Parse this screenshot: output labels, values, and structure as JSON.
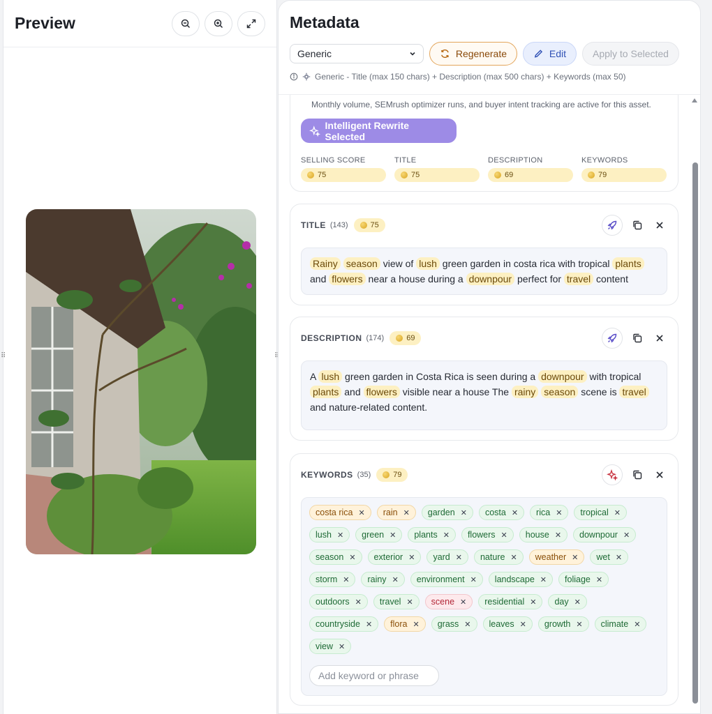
{
  "preview": {
    "title": "Preview",
    "tools": [
      {
        "name": "zoom-out-icon"
      },
      {
        "name": "zoom-in-icon"
      },
      {
        "name": "expand-icon"
      }
    ]
  },
  "metadata": {
    "title": "Metadata",
    "preset_select": "Generic",
    "regenerate_label": "Regenerate",
    "edit_label": "Edit",
    "apply_label": "Apply to Selected",
    "hint": "Generic - Title (max 150 chars) + Description (max 500 chars) + Keywords (max 50)"
  },
  "score_card": {
    "note": "Monthly volume, SEMrush optimizer runs, and buyer intent tracking are active for this asset.",
    "rewrite_label": "Intelligent Rewrite Selected",
    "scores": [
      {
        "label": "SELLING SCORE",
        "value": "75"
      },
      {
        "label": "TITLE",
        "value": "75"
      },
      {
        "label": "DESCRIPTION",
        "value": "69"
      },
      {
        "label": "KEYWORDS",
        "value": "79"
      }
    ]
  },
  "title_section": {
    "label": "TITLE",
    "count": "(143)",
    "score": "75",
    "segments": [
      {
        "text": "Rainy",
        "hl": true
      },
      {
        "text": " ",
        "hl": false
      },
      {
        "text": "season",
        "hl": true
      },
      {
        "text": " view of ",
        "hl": false
      },
      {
        "text": "lush",
        "hl": true
      },
      {
        "text": " green garden in costa rica with tropical ",
        "hl": false
      },
      {
        "text": "plants",
        "hl": true
      },
      {
        "text": " and ",
        "hl": false
      },
      {
        "text": "flowers",
        "hl": true
      },
      {
        "text": " near a house during a ",
        "hl": false
      },
      {
        "text": "downpour",
        "hl": true
      },
      {
        "text": " perfect for ",
        "hl": false
      },
      {
        "text": "travel",
        "hl": true
      },
      {
        "text": " content",
        "hl": false
      }
    ]
  },
  "description_section": {
    "label": "DESCRIPTION",
    "count": "(174)",
    "score": "69",
    "segments": [
      {
        "text": "A ",
        "hl": false
      },
      {
        "text": "lush",
        "hl": true
      },
      {
        "text": " green garden in Costa Rica is seen during a ",
        "hl": false
      },
      {
        "text": "downpour",
        "hl": true
      },
      {
        "text": " with tropical ",
        "hl": false
      },
      {
        "text": "plants",
        "hl": true
      },
      {
        "text": " and ",
        "hl": false
      },
      {
        "text": "flowers",
        "hl": true
      },
      {
        "text": " visible near a house The ",
        "hl": false
      },
      {
        "text": "rainy",
        "hl": true
      },
      {
        "text": " ",
        "hl": false
      },
      {
        "text": "season",
        "hl": true
      },
      {
        "text": " scene is ",
        "hl": false
      },
      {
        "text": "travel",
        "hl": true
      },
      {
        "text": " and nature-related content.",
        "hl": false
      }
    ]
  },
  "keywords_section": {
    "label": "KEYWORDS",
    "count": "(35)",
    "score": "79",
    "input_placeholder": "Add keyword or phrase",
    "keywords": [
      {
        "text": "costa rica",
        "tone": "orange"
      },
      {
        "text": "rain",
        "tone": "orange"
      },
      {
        "text": "garden",
        "tone": "green"
      },
      {
        "text": "costa",
        "tone": "green"
      },
      {
        "text": "rica",
        "tone": "green"
      },
      {
        "text": "tropical",
        "tone": "green"
      },
      {
        "text": "lush",
        "tone": "green"
      },
      {
        "text": "green",
        "tone": "green"
      },
      {
        "text": "plants",
        "tone": "green"
      },
      {
        "text": "flowers",
        "tone": "green"
      },
      {
        "text": "house",
        "tone": "green"
      },
      {
        "text": "downpour",
        "tone": "green"
      },
      {
        "text": "season",
        "tone": "green"
      },
      {
        "text": "exterior",
        "tone": "green"
      },
      {
        "text": "yard",
        "tone": "green"
      },
      {
        "text": "nature",
        "tone": "green"
      },
      {
        "text": "weather",
        "tone": "orange"
      },
      {
        "text": "wet",
        "tone": "green"
      },
      {
        "text": "storm",
        "tone": "green"
      },
      {
        "text": "rainy",
        "tone": "green"
      },
      {
        "text": "environment",
        "tone": "green"
      },
      {
        "text": "landscape",
        "tone": "green"
      },
      {
        "text": "foliage",
        "tone": "green"
      },
      {
        "text": "outdoors",
        "tone": "green"
      },
      {
        "text": "travel",
        "tone": "green"
      },
      {
        "text": "scene",
        "tone": "red"
      },
      {
        "text": "residential",
        "tone": "green"
      },
      {
        "text": "day",
        "tone": "green"
      },
      {
        "text": "countryside",
        "tone": "green"
      },
      {
        "text": "flora",
        "tone": "orange"
      },
      {
        "text": "grass",
        "tone": "green"
      },
      {
        "text": "leaves",
        "tone": "green"
      },
      {
        "text": "growth",
        "tone": "green"
      },
      {
        "text": "climate",
        "tone": "green"
      },
      {
        "text": "view",
        "tone": "green"
      }
    ]
  },
  "colors": {
    "accent_purple": "#9d8be6",
    "highlight": "#fdf0c2",
    "chip_green": "#e9f7ec",
    "chip_orange": "#fff2da",
    "chip_red": "#fde9ec"
  }
}
